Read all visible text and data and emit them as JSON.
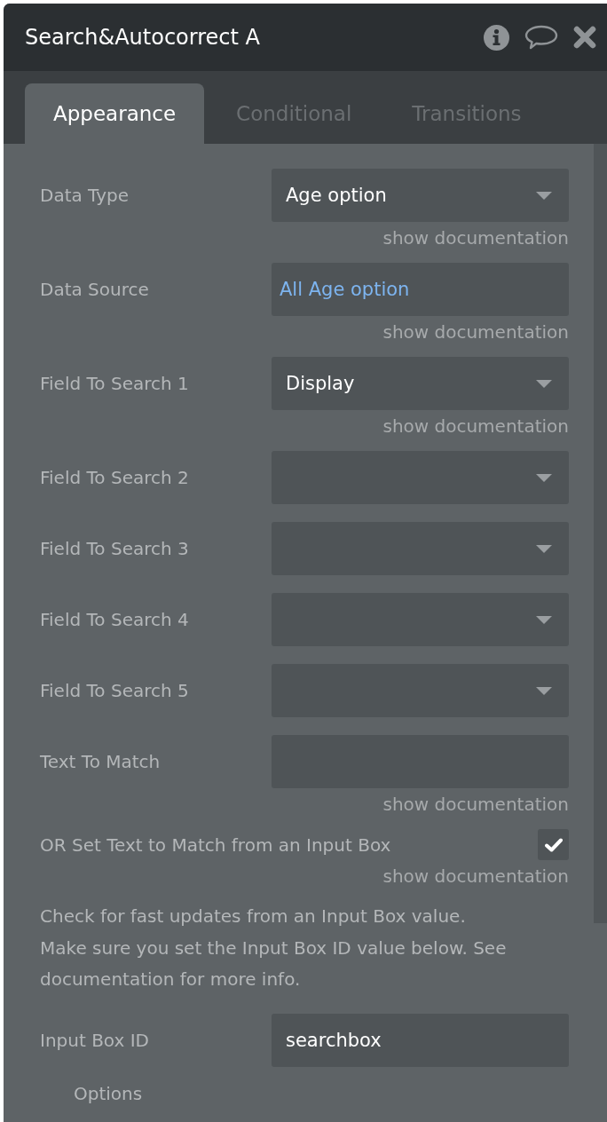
{
  "panel": {
    "title": "Search&Autocorrect A"
  },
  "tabs": [
    {
      "label": "Appearance",
      "selected": true
    },
    {
      "label": "Conditional",
      "selected": false
    },
    {
      "label": "Transitions",
      "selected": false
    }
  ],
  "properties": [
    {
      "kind": "dropdown",
      "label": "Data Type",
      "value": "Age option",
      "doc_link": "show documentation"
    },
    {
      "kind": "expression",
      "label": "Data Source",
      "value": "All Age option",
      "doc_link": "show documentation"
    },
    {
      "kind": "dropdown",
      "label": "Field To Search 1",
      "value": "Display",
      "doc_link": "show documentation"
    },
    {
      "kind": "dropdown",
      "label": "Field To Search 2"
    },
    {
      "kind": "dropdown",
      "label": "Field To Search 3"
    },
    {
      "kind": "dropdown",
      "label": "Field To Search 4"
    },
    {
      "kind": "dropdown",
      "label": "Field To Search 5"
    },
    {
      "kind": "text",
      "label": "Text To Match",
      "doc_link": "show documentation"
    },
    {
      "kind": "checkbox",
      "label": "OR Set Text to Match from an Input Box",
      "checked": true,
      "doc_link": "show documentation"
    },
    {
      "kind": "note",
      "text": "Check for fast updates from an Input Box value.\nMake sure you set the Input Box ID value below. See documentation for more info."
    },
    {
      "kind": "text",
      "label": "Input Box ID",
      "value": "searchbox"
    },
    {
      "kind": "section",
      "label": "Options"
    }
  ]
}
